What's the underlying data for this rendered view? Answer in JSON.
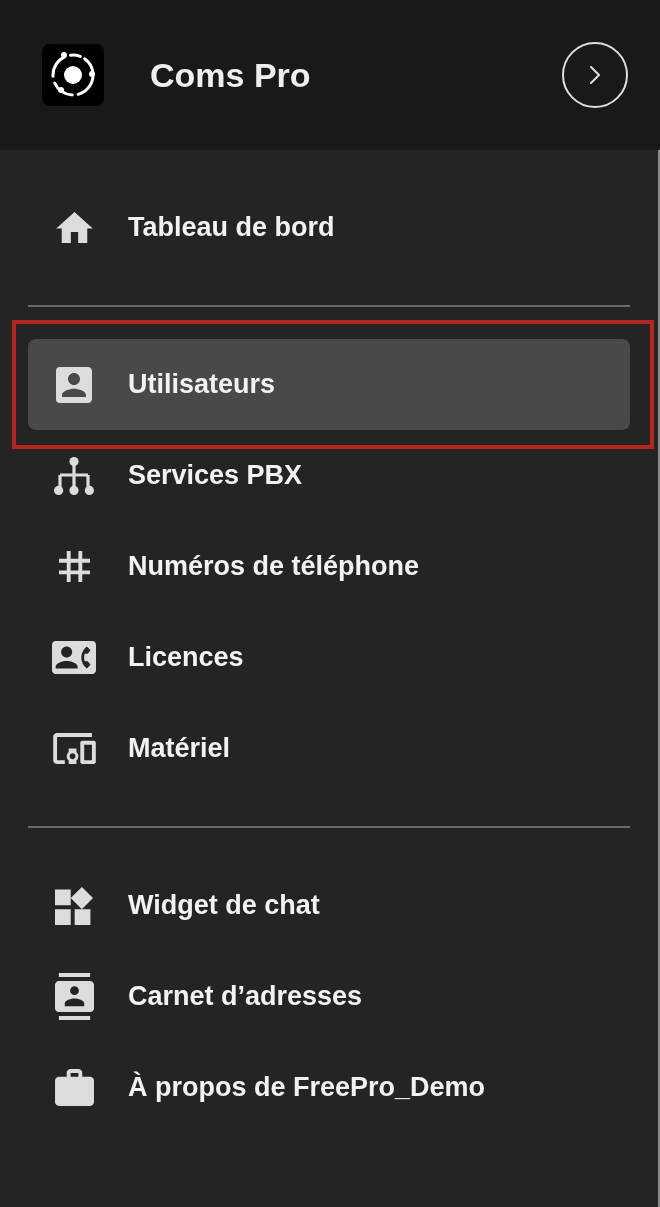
{
  "header": {
    "title": "Coms Pro"
  },
  "nav_sections": [
    {
      "items": [
        {
          "kind": "home",
          "label": "Tableau de bord",
          "selected": false,
          "highlighted": false
        }
      ]
    },
    {
      "items": [
        {
          "kind": "users",
          "label": "Utilisateurs",
          "selected": true,
          "highlighted": true
        },
        {
          "kind": "pbx",
          "label": "Services PBX",
          "selected": false,
          "highlighted": false
        },
        {
          "kind": "numbers",
          "label": "Numéros de téléphone",
          "selected": false,
          "highlighted": false
        },
        {
          "kind": "licences",
          "label": "Licences",
          "selected": false,
          "highlighted": false
        },
        {
          "kind": "hardware",
          "label": "Matériel",
          "selected": false,
          "highlighted": false
        }
      ]
    },
    {
      "items": [
        {
          "kind": "widget",
          "label": "Widget de chat",
          "selected": false,
          "highlighted": false
        },
        {
          "kind": "contacts",
          "label": "Carnet d’adresses",
          "selected": false,
          "highlighted": false
        },
        {
          "kind": "about",
          "label": "À propos de FreePro_Demo",
          "selected": false,
          "highlighted": false
        }
      ]
    }
  ]
}
